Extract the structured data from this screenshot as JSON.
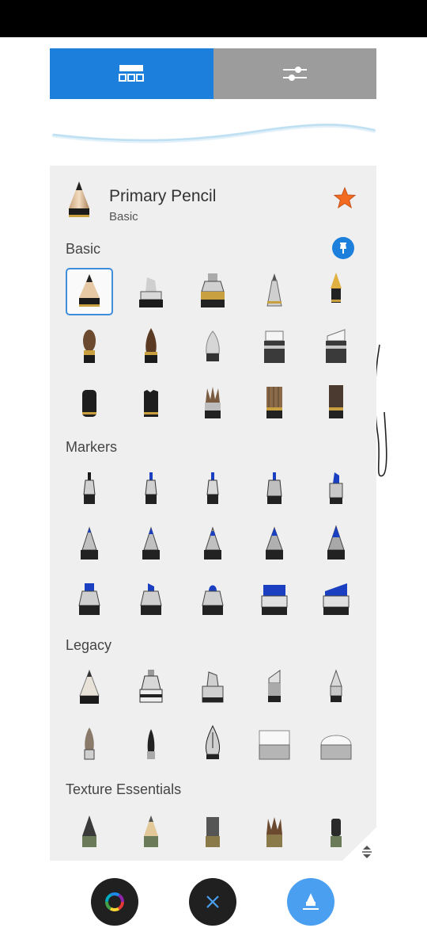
{
  "tabs": [
    {
      "name": "brush-library",
      "icon": "brush-grid-icon",
      "active": true
    },
    {
      "name": "brush-properties",
      "icon": "sliders-icon",
      "active": false
    }
  ],
  "colors": {
    "accent": "#1c7fdc",
    "inactive_tab": "#9c9c9c",
    "panel_bg": "#efefef",
    "star": "#f26b21"
  },
  "current_brush": {
    "name": "Primary Pencil",
    "category": "Basic",
    "favorite": true
  },
  "sections": [
    {
      "label": "Basic",
      "pinned": true,
      "rows": 3
    },
    {
      "label": "Markers",
      "pinned": false,
      "rows": 3
    },
    {
      "label": "Legacy",
      "pinned": false,
      "rows": 2
    },
    {
      "label": "Texture Essentials",
      "pinned": false,
      "rows": 1
    }
  ],
  "bottom_bar": {
    "color_button": "color-wheel-icon",
    "close_button": "close-icon",
    "brush_button": "brush-icon"
  }
}
